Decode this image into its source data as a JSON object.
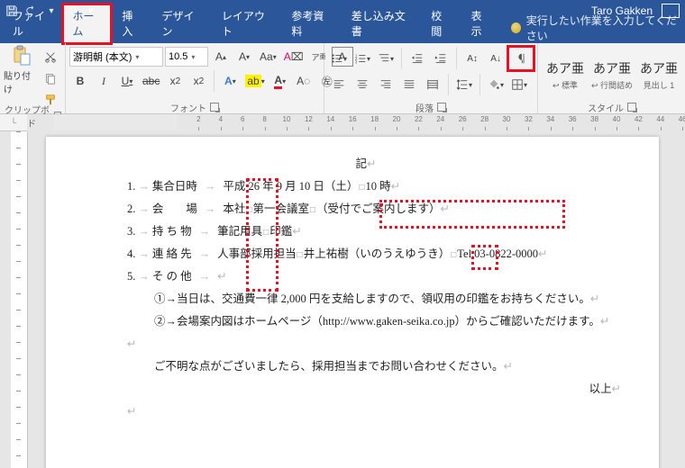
{
  "title_user": "Taro Gakken",
  "qat": {
    "save": "保存",
    "undo": "元に戻す",
    "redo": "やり直し",
    "customize": "カスタマイズ"
  },
  "menu": {
    "file": "ファイル",
    "home": "ホーム",
    "insert": "挿入",
    "design": "デザイン",
    "layout": "レイアウト",
    "references": "参考資料",
    "mailings": "差し込み文書",
    "review": "校閲",
    "view": "表示",
    "tellme": "実行したい作業を入力してください"
  },
  "ribbon": {
    "clipboard": {
      "label": "クリップボード",
      "paste": "貼り付け"
    },
    "font": {
      "label": "フォント",
      "face": "游明朝 (本文)",
      "size": "10.5",
      "bold": "B",
      "italic": "I",
      "underline": "U"
    },
    "paragraph": {
      "label": "段落",
      "show_marks": "編集記号の表示/非表示"
    },
    "styles": {
      "label": "スタイル",
      "items": [
        {
          "sample": "あア亜",
          "name": "↩ 標準"
        },
        {
          "sample": "あア亜",
          "name": "↩ 行間詰め"
        },
        {
          "sample": "あア亜",
          "name": "見出し 1"
        }
      ]
    }
  },
  "ruler": {
    "hmarks": [
      2,
      4,
      6,
      8,
      10,
      12,
      14,
      16,
      18,
      20,
      22,
      24,
      26,
      28,
      30,
      32,
      34,
      36,
      38,
      40,
      42,
      44,
      46
    ]
  },
  "doc": {
    "heading": "記",
    "rows": [
      {
        "n": "1.",
        "k": "集合日時",
        "v": "平成 26 年 9 月 10 日（土）",
        "v2": "10 時"
      },
      {
        "n": "2.",
        "k": "会　　場",
        "v": "本社",
        "v2": "第一会議室",
        "v3": "（受付でご案内します）"
      },
      {
        "n": "3.",
        "k": "持 ち 物",
        "v": "筆記用具",
        "v2": "印鑑"
      },
      {
        "n": "4.",
        "k": "連 絡 先",
        "v": "人事部採用担当",
        "v2": "井上祐樹（いのうえゆうき）",
        "v3": "Tel.03-0822-0000"
      },
      {
        "n": "5.",
        "k": "そ の 他",
        "v": ""
      }
    ],
    "notes": [
      "①→当日は、交通費一律 2,000 円を支給しますので、領収用の印鑑をお持ちください。",
      "②→会場案内図はホームページ（http://www.gaken-seika.co.jp）からご確認いただけます。"
    ],
    "closing1": "ご不明な点がございましたら、採用担当までお問い合わせください。",
    "closing2": "以上"
  }
}
